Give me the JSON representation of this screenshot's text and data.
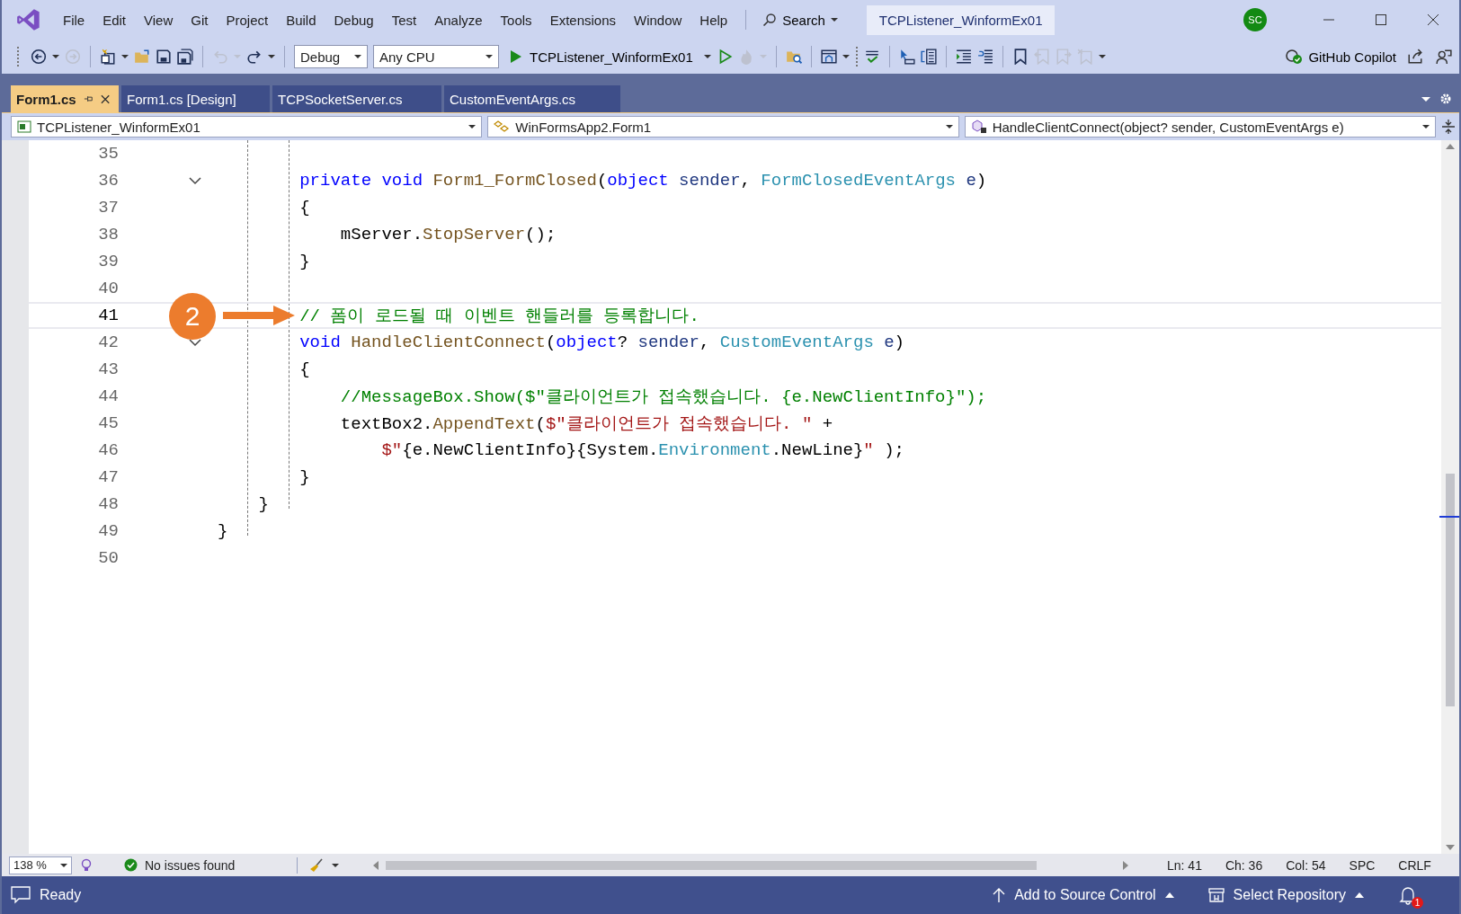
{
  "title_bar": {
    "menu": [
      "File",
      "Edit",
      "View",
      "Git",
      "Project",
      "Build",
      "Debug",
      "Test",
      "Analyze",
      "Tools",
      "Extensions",
      "Window",
      "Help"
    ],
    "search": {
      "label": "Search"
    },
    "solution_title": "TCPListener_WinformEx01",
    "account": {
      "initials": "SC"
    }
  },
  "toolbar": {
    "buttons_left": [
      {
        "disabled": false
      },
      {
        "disabled": true
      },
      {
        "disabled": false
      },
      {
        "disabled": false
      },
      {
        "disabled": false
      },
      {
        "disabled": false
      },
      {
        "disabled": true
      },
      {
        "disabled": false
      }
    ],
    "configuration": {
      "value": "Debug"
    },
    "platform": {
      "value": "Any CPU"
    },
    "start_button": {
      "label": "TCPListener_WinformEx01"
    },
    "buttons_right": [
      {
        "disabled": false
      },
      {
        "disabled": true
      },
      {
        "disabled": false
      },
      {
        "disabled": false
      },
      {
        "disabled": false
      },
      {
        "disabled": false
      },
      {
        "disabled": false
      },
      {
        "disabled": false
      },
      {
        "disabled": false
      },
      {
        "disabled": false
      },
      {
        "disabled": true
      },
      {
        "disabled": true
      },
      {
        "disabled": true
      }
    ],
    "copilot": {
      "label": "GitHub Copilot"
    }
  },
  "tabs": [
    {
      "label": "Form1.cs",
      "selected": true,
      "pinned": true
    },
    {
      "label": "Form1.cs [Design]",
      "selected": false,
      "pinned": false
    },
    {
      "label": "TCPSocketServer.cs",
      "selected": false,
      "pinned": false
    },
    {
      "label": "CustomEventArgs.cs",
      "selected": false,
      "pinned": false
    }
  ],
  "navigation_bar": {
    "project": "TCPListener_WinformEx01",
    "type": "WinFormsApp2.Form1",
    "member": "HandleClientConnect(object? sender, CustomEventArgs e)"
  },
  "editor": {
    "annotation": {
      "label": "2"
    },
    "lines": [
      {
        "number": "35",
        "fold": false,
        "current": false
      },
      {
        "number": "36",
        "fold": true,
        "current": false,
        "tokens": [
          {
            "kind": "keyword",
            "text": "        private void "
          },
          {
            "kind": "method",
            "text": "Form1_FormClosed"
          },
          {
            "kind": "plain",
            "text": "("
          },
          {
            "kind": "keyword",
            "text": "object"
          },
          {
            "kind": "param",
            "text": " sender"
          },
          {
            "kind": "plain",
            "text": ", "
          },
          {
            "kind": "type",
            "text": "FormClosedEventArgs"
          },
          {
            "kind": "param",
            "text": " e"
          },
          {
            "kind": "plain",
            "text": ")"
          }
        ]
      },
      {
        "number": "37",
        "fold": false,
        "current": false,
        "tokens": [
          {
            "kind": "plain",
            "text": "        {"
          }
        ]
      },
      {
        "number": "38",
        "fold": false,
        "current": false,
        "tokens": [
          {
            "kind": "plain",
            "text": "            mServer."
          },
          {
            "kind": "method",
            "text": "StopServer"
          },
          {
            "kind": "plain",
            "text": "();"
          }
        ]
      },
      {
        "number": "39",
        "fold": false,
        "current": false,
        "tokens": [
          {
            "kind": "plain",
            "text": "        }"
          }
        ]
      },
      {
        "number": "40",
        "fold": false,
        "current": false
      },
      {
        "number": "41",
        "fold": false,
        "current": true,
        "tokens": [
          {
            "kind": "comment",
            "text": "        // 폼이 로드될 때 이벤트 핸들러를 등록합니다."
          }
        ]
      },
      {
        "number": "42",
        "fold": true,
        "current": false,
        "tokens": [
          {
            "kind": "keyword",
            "text": "        void "
          },
          {
            "kind": "method",
            "text": "HandleClientConnect"
          },
          {
            "kind": "plain",
            "text": "("
          },
          {
            "kind": "keyword",
            "text": "object"
          },
          {
            "kind": "plain",
            "text": "? "
          },
          {
            "kind": "param",
            "text": "sender"
          },
          {
            "kind": "plain",
            "text": ", "
          },
          {
            "kind": "type",
            "text": "CustomEventArgs"
          },
          {
            "kind": "param",
            "text": " e"
          },
          {
            "kind": "plain",
            "text": ")"
          }
        ]
      },
      {
        "number": "43",
        "fold": false,
        "current": false,
        "tokens": [
          {
            "kind": "plain",
            "text": "        {"
          }
        ]
      },
      {
        "number": "44",
        "fold": false,
        "current": false,
        "tokens": [
          {
            "kind": "comment",
            "text": "            //MessageBox.Show($\"클라이언트가 접속했습니다. {e.NewClientInfo}\");"
          }
        ]
      },
      {
        "number": "45",
        "fold": false,
        "current": false,
        "tokens": [
          {
            "kind": "plain",
            "text": "            textBox2."
          },
          {
            "kind": "method",
            "text": "AppendText"
          },
          {
            "kind": "plain",
            "text": "("
          },
          {
            "kind": "string",
            "text": "$\"클라이언트가 접속했습니다. \""
          },
          {
            "kind": "plain",
            "text": " +"
          }
        ]
      },
      {
        "number": "46",
        "fold": false,
        "current": false,
        "tokens": [
          {
            "kind": "string",
            "text": "                $\""
          },
          {
            "kind": "plain",
            "text": "{e.NewClientInfo}{System."
          },
          {
            "kind": "type",
            "text": "Environment"
          },
          {
            "kind": "plain",
            "text": ".NewLine}"
          },
          {
            "kind": "string",
            "text": "\""
          },
          {
            "kind": "plain",
            "text": " );"
          }
        ]
      },
      {
        "number": "47",
        "fold": false,
        "current": false,
        "tokens": [
          {
            "kind": "plain",
            "text": "        }"
          }
        ]
      },
      {
        "number": "48",
        "fold": false,
        "current": false,
        "tokens": [
          {
            "kind": "plain",
            "text": "    }"
          }
        ]
      },
      {
        "number": "49",
        "fold": false,
        "current": false,
        "tokens": [
          {
            "kind": "plain",
            "text": "}"
          }
        ]
      },
      {
        "number": "50",
        "fold": false,
        "current": false
      }
    ]
  },
  "editor_status": {
    "zoom": "138 %",
    "issues": "No issues found",
    "position": [
      "Ln: 41",
      "Ch: 36",
      "Col: 54"
    ],
    "whitespace": "SPC",
    "line_endings": "CRLF"
  },
  "status_bar": {
    "state": "Ready",
    "source_control": "Add to Source Control",
    "repository": "Select Repository",
    "notifications": "1"
  }
}
